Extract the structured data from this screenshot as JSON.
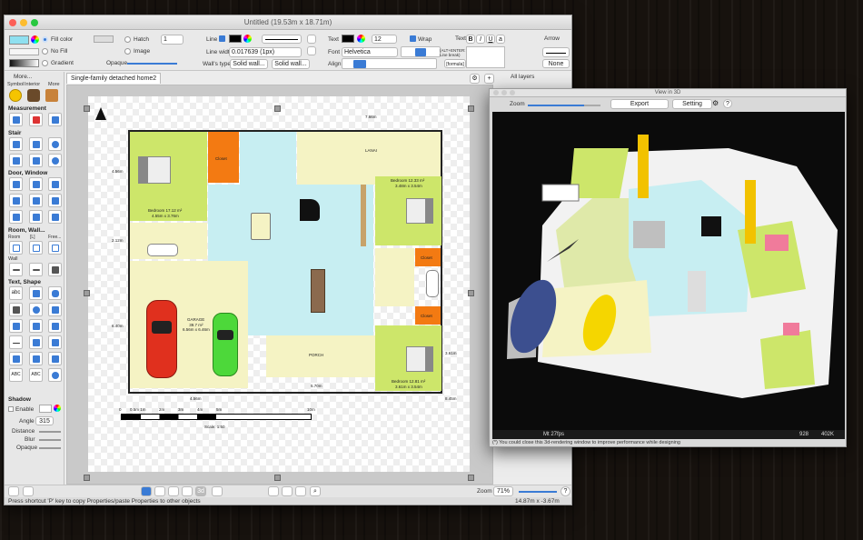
{
  "main_window": {
    "title": "Untitled (19.53m x 18.71m)",
    "toolbar": {
      "fill_color": "Fill color",
      "no_fill": "No Fill",
      "gradient": "Gradient",
      "hatch": "Hatch",
      "image": "Image",
      "hatch_value": "1",
      "opaque": "Opaque",
      "line": "Line",
      "line_width_label": "Line width",
      "line_width_value": "0.017639 (1px)",
      "walls_type": "Wall's type",
      "wall1": "Solid wall...",
      "wall2": "Solid wall...",
      "text": "Text",
      "font_size": "12",
      "wrap": "Wrap",
      "font_label": "Font",
      "font_value": "Helvetica",
      "align": "Align",
      "text2": "Text",
      "alt_enter": "(ALT+ENTER: Line break)",
      "formula": "[formula]",
      "arrow": "Arrow",
      "arrow_none": "None"
    },
    "sidebar": {
      "more": "More...",
      "tabs": [
        "Symbol",
        "Interior",
        "More"
      ],
      "sections": [
        "Measurement",
        "Stair",
        "Door, Window",
        "Room, Wall...",
        "Text, Shape",
        "Shadow"
      ],
      "room_labels": [
        "Room",
        "[L]",
        "Free..."
      ],
      "wall": "Wall",
      "shadow": {
        "enable": "Enable",
        "angle_label": "Angle",
        "angle_value": "315",
        "distance": "Distance",
        "blur": "Blur",
        "opaque": "Opaque"
      }
    },
    "doc_tab": "Single-family detached home2",
    "layers": "All layers",
    "plan": {
      "rooms": [
        {
          "name": "Bedroom 17.12 m²",
          "size": "4.55m x 3.76m"
        },
        {
          "name": "Closet",
          "size": ""
        },
        {
          "name": "LANAI",
          "size": ""
        },
        {
          "name": "Bedroom 12.33 m²",
          "size": "3.48m x 3.54m"
        },
        {
          "name": "Closet",
          "size": ""
        },
        {
          "name": "Closet",
          "size": ""
        },
        {
          "name": "GARAGE",
          "size": "39.7 m²\n6.56m x 6.46m"
        },
        {
          "name": "PORCH",
          "size": ""
        },
        {
          "name": "Bedroom 12.81 m²",
          "size": "3.61m x 3.54m"
        }
      ],
      "dimensions": [
        "7.66m",
        "4.56m",
        "2.12m",
        "6.40m",
        "4.56m",
        "5.70m",
        "8.45m",
        "3.61m"
      ],
      "scale_ticks": [
        "0",
        "0.5m 1m",
        "2m",
        "3m",
        "4m",
        "5m",
        "10m"
      ],
      "scale_label": "Scale: 1:50"
    },
    "bottom": {
      "zoom_label": "Zoom",
      "zoom_value": "71%",
      "status": "Press shortcut 'P' key to copy Properties/paste Properties to other objects",
      "coords": "14.87m x -3.67m",
      "btn_3d": "3d"
    }
  },
  "view3d": {
    "title": "View in 3D",
    "zoom": "Zoom",
    "export": "Export",
    "setting": "Setting",
    "help": "?",
    "fps": "Mt 27fps",
    "tris": "928",
    "verts": "402K",
    "hint": "(*) You could close this 3d-rendering window to improve performance while designing"
  },
  "colors": {
    "room_green": "#cde66a",
    "room_cyan": "#c7eef2",
    "room_yellow": "#f5f3c4",
    "closet_orange": "#f37a12",
    "accent_blue": "#3a7bd5"
  }
}
